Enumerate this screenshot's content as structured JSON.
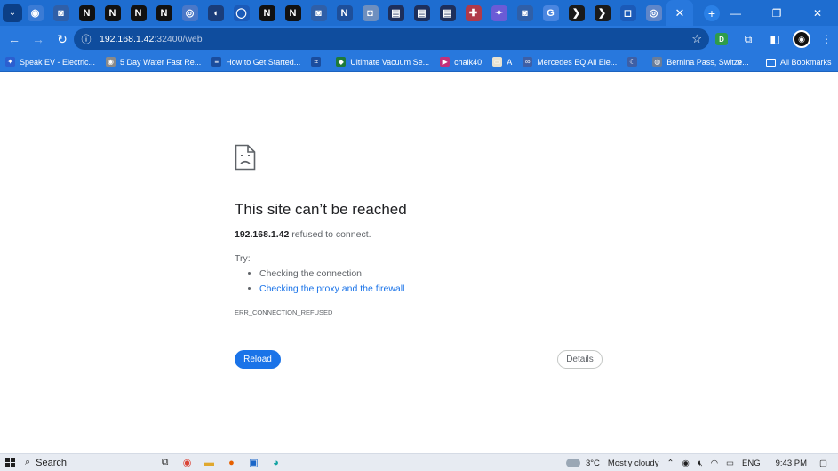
{
  "window": {
    "controls": {
      "minimize": "—",
      "restore": "❐",
      "close": "✕"
    }
  },
  "tabs": [
    {
      "icon": "web-circle-icon",
      "glyph": "◉",
      "color": "#3a7bd5"
    },
    {
      "icon": "plex-icon",
      "glyph": "◙",
      "color": "#2f5fa8"
    },
    {
      "icon": "notion-icon",
      "glyph": "N",
      "color": "#111111"
    },
    {
      "icon": "notion-icon",
      "glyph": "N",
      "color": "#111111"
    },
    {
      "icon": "notion-icon",
      "glyph": "N",
      "color": "#111111"
    },
    {
      "icon": "notion-icon",
      "glyph": "N",
      "color": "#111111"
    },
    {
      "icon": "web-icon",
      "glyph": "◎",
      "color": "#4a78c8"
    },
    {
      "icon": "speaker-icon",
      "glyph": "◖",
      "color": "#1a3d7a"
    },
    {
      "icon": "circle-app-icon",
      "glyph": "◯",
      "color": "#1b5ab8"
    },
    {
      "icon": "notion-icon",
      "glyph": "N",
      "color": "#111111"
    },
    {
      "icon": "notion-icon",
      "glyph": "N",
      "color": "#111111"
    },
    {
      "icon": "plex-icon",
      "glyph": "◙",
      "color": "#2f5fa8"
    },
    {
      "icon": "n-circle-icon",
      "glyph": "N",
      "color": "#1e4f9a"
    },
    {
      "icon": "square-app-icon",
      "glyph": "◘",
      "color": "#6e8fbf"
    },
    {
      "icon": "chart-app-icon",
      "glyph": "▤",
      "color": "#1d2f5c"
    },
    {
      "icon": "chart-app-icon",
      "glyph": "▤",
      "color": "#1d2f5c"
    },
    {
      "icon": "chart-app-icon",
      "glyph": "▤",
      "color": "#1d2f5c"
    },
    {
      "icon": "gift-app-icon",
      "glyph": "✚",
      "color": "#b03a4a"
    },
    {
      "icon": "purple-app-icon",
      "glyph": "✦",
      "color": "#6b5bd6"
    },
    {
      "icon": "plex-icon",
      "glyph": "◙",
      "color": "#2f5fa8"
    },
    {
      "icon": "google-icon",
      "glyph": "G",
      "color": "#4a86e0"
    },
    {
      "icon": "prompt-app-icon",
      "glyph": "❯",
      "color": "#1a1a1a"
    },
    {
      "icon": "prompt-app-icon",
      "glyph": "❯",
      "color": "#1a1a1a"
    },
    {
      "icon": "screen-app-icon",
      "glyph": "◻",
      "color": "#1b5ab8"
    },
    {
      "icon": "web-icon",
      "glyph": "◎",
      "color": "#5f86c9"
    }
  ],
  "active_tab": {
    "close": "✕"
  },
  "new_tab_label": "+",
  "toolbar": {
    "url_host": "192.168.1.42",
    "url_rest": ":32400/web"
  },
  "bookmarks": [
    {
      "label": "Speak EV - Electric...",
      "icon": "speak-ev-icon",
      "color": "#2b5fd0",
      "glyph": "✦"
    },
    {
      "label": "5 Day Water Fast Re...",
      "icon": "web-globe-icon",
      "color": "#8a8a8a",
      "glyph": "◉"
    },
    {
      "label": "How to Get Started...",
      "icon": "blog-icon",
      "color": "#1a4d9e",
      "glyph": "≡"
    },
    {
      "label": "",
      "icon": "frame-icon",
      "color": "#1a4d9e",
      "glyph": "⌗"
    },
    {
      "label": "Ultimate Vacuum Se...",
      "icon": "shield-bookmark-icon",
      "color": "#1e7a3a",
      "glyph": "◆"
    },
    {
      "label": "chalk40",
      "icon": "play-bookmark-icon",
      "color": "#c2307a",
      "glyph": "▶"
    },
    {
      "label": "A",
      "icon": "image-bookmark-icon",
      "color": "#e8e2d0",
      "glyph": "▭"
    },
    {
      "label": "Mercedes EQ All Ele...",
      "icon": "link-bookmark-icon",
      "color": "#3d5fa6",
      "glyph": "∞"
    },
    {
      "label": "",
      "icon": "moon-bookmark-icon",
      "color": "#3d5fa6",
      "glyph": "☾"
    },
    {
      "label": "Bernina Pass, Switze...",
      "icon": "globe-bookmark-icon",
      "color": "#6a7d99",
      "glyph": "◍"
    }
  ],
  "bookmarks_more": "»",
  "all_bookmarks_label": "All Bookmarks",
  "error": {
    "title": "This site can’t be reached",
    "host": "192.168.1.42",
    "message_rest": " refused to connect.",
    "try_label": "Try:",
    "suggestions": [
      {
        "text": "Checking the connection",
        "link": false
      },
      {
        "text": "Checking the proxy and the firewall",
        "link": true
      }
    ],
    "code": "ERR_CONNECTION_REFUSED",
    "reload_label": "Reload",
    "details_label": "Details"
  },
  "taskbar": {
    "search_label": "Search",
    "weather": "3°C",
    "weather_text": "Mostly cloudy",
    "language": "ENG",
    "time": "9:43 PM"
  }
}
